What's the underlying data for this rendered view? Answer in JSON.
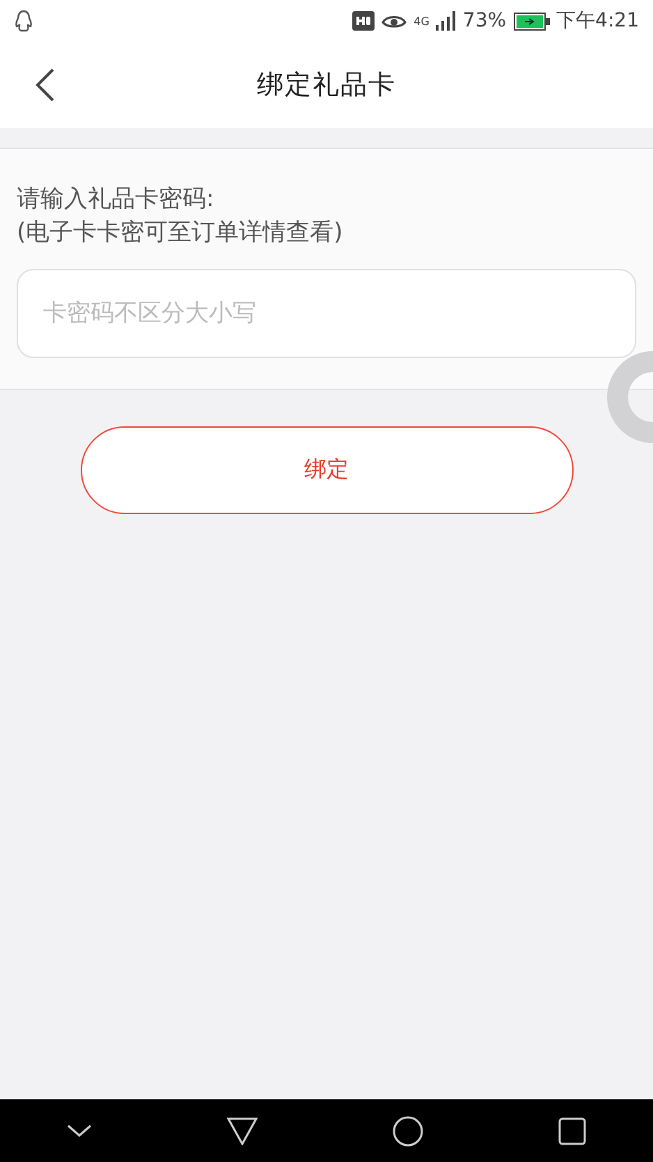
{
  "status_bar": {
    "battery_percent": "73%",
    "time": "下午4:21",
    "network": "4G"
  },
  "header": {
    "title": "绑定礼品卡"
  },
  "form": {
    "label": "请输入礼品卡密码:",
    "hint": "(电子卡卡密可至订单详情查看)",
    "field": {
      "placeholder": "卡密码不区分大小写"
    }
  },
  "bind_button": {
    "label": "绑定"
  }
}
